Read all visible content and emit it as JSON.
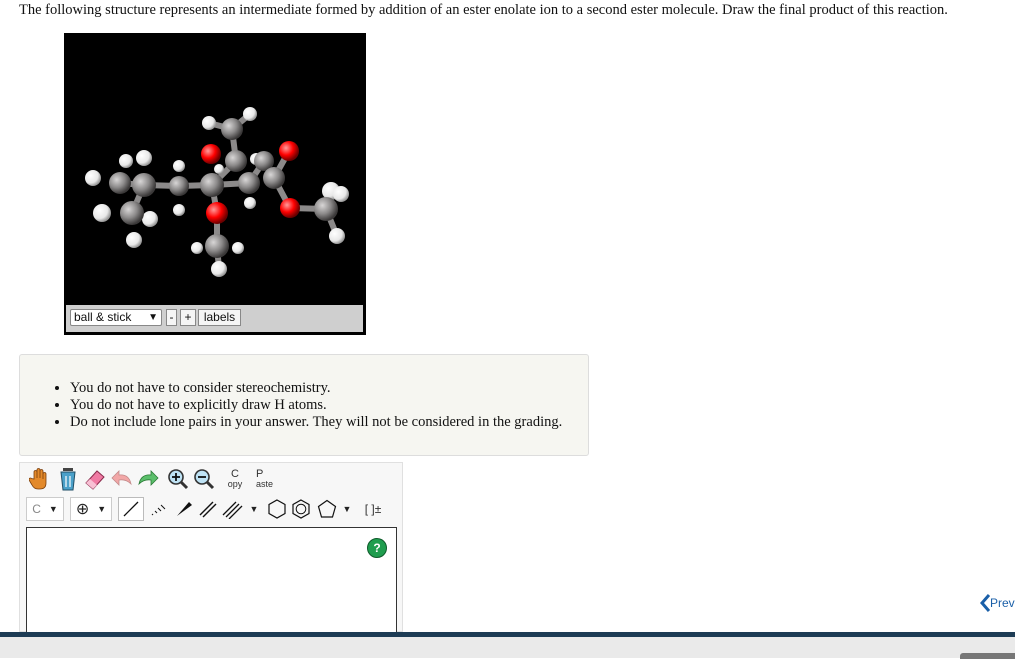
{
  "question": "The following structure represents an intermediate formed by addition of an ester enolate ion to a second ester molecule. Draw the final product of this reaction.",
  "viewer": {
    "display_mode": "ball & stick",
    "zoom_out_label": "-",
    "zoom_in_label": "+",
    "labels_button": "labels"
  },
  "instructions": [
    "You do not have to consider stereochemistry.",
    "You do not have to explicitly draw H atoms.",
    "Do not include lone pairs in your answer. They will not be considered in the grading."
  ],
  "editor": {
    "copy_top": "C",
    "copy_bottom": "opy",
    "paste_top": "P",
    "paste_bottom": "aste",
    "element": "C",
    "charge_symbol": "⊕",
    "bracket_label": "[ ]±",
    "help_label": "?"
  },
  "nav": {
    "prev_label": "Prev"
  },
  "colors": {
    "carbon": "#8c8a8a",
    "oxygen": "#ff0000",
    "hydrogen": "#ffffff",
    "bar": "#1d3c55",
    "help": "#1f9d4e"
  }
}
